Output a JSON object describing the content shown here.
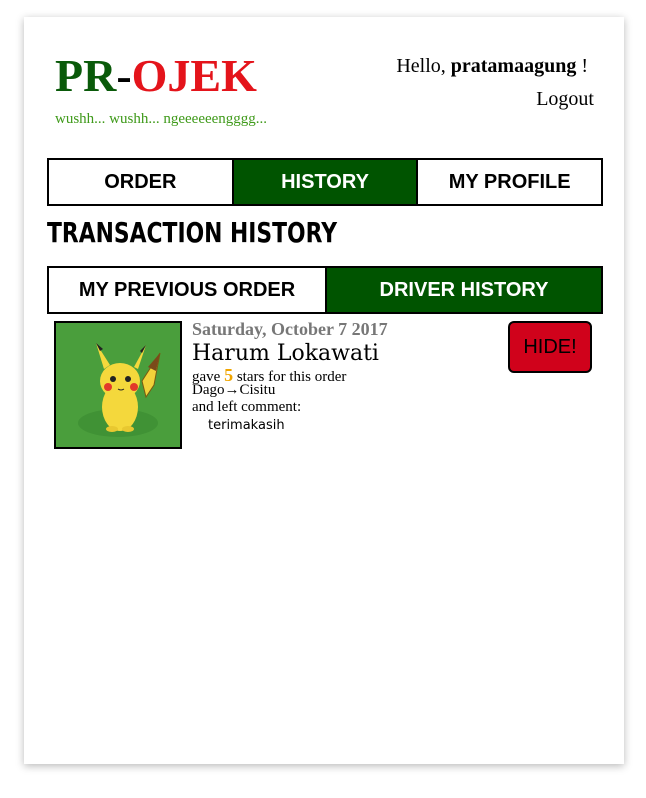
{
  "header": {
    "logo_prefix": "PR",
    "logo_dash": "-",
    "logo_suffix": "OJEK",
    "tagline": "wushh... wushh... ngeeeeeengggg...",
    "greeting_prefix": "Hello, ",
    "username": "pratamaagung",
    "greeting_suffix": " !",
    "logout_label": "Logout"
  },
  "nav": {
    "items": [
      {
        "label": "ORDER",
        "active": false
      },
      {
        "label": "HISTORY",
        "active": true
      },
      {
        "label": "MY PROFILE",
        "active": false
      }
    ]
  },
  "page": {
    "title": "TRANSACTION HISTORY"
  },
  "subtabs": {
    "items": [
      {
        "label": "MY PREVIOUS ORDER",
        "active": false
      },
      {
        "label": "DRIVER HISTORY",
        "active": true
      }
    ]
  },
  "history": {
    "entries": [
      {
        "date": "Saturday, October 7 2017",
        "name": "Harum Lokawati",
        "gave_label": "gave ",
        "stars": "5",
        "stars_suffix": " stars for this order",
        "route_from": "Dago",
        "route_arrow": "→",
        "route_to": "Cisitu",
        "comment_label": "and left comment:",
        "comment": "terimakasih",
        "hide_label": "HIDE!"
      }
    ]
  },
  "colors": {
    "brand_green": "#0a5a0a",
    "brand_red": "#e4141b",
    "active_tab": "#005400",
    "hide_button": "#d0021b",
    "stars": "#f0a500"
  }
}
